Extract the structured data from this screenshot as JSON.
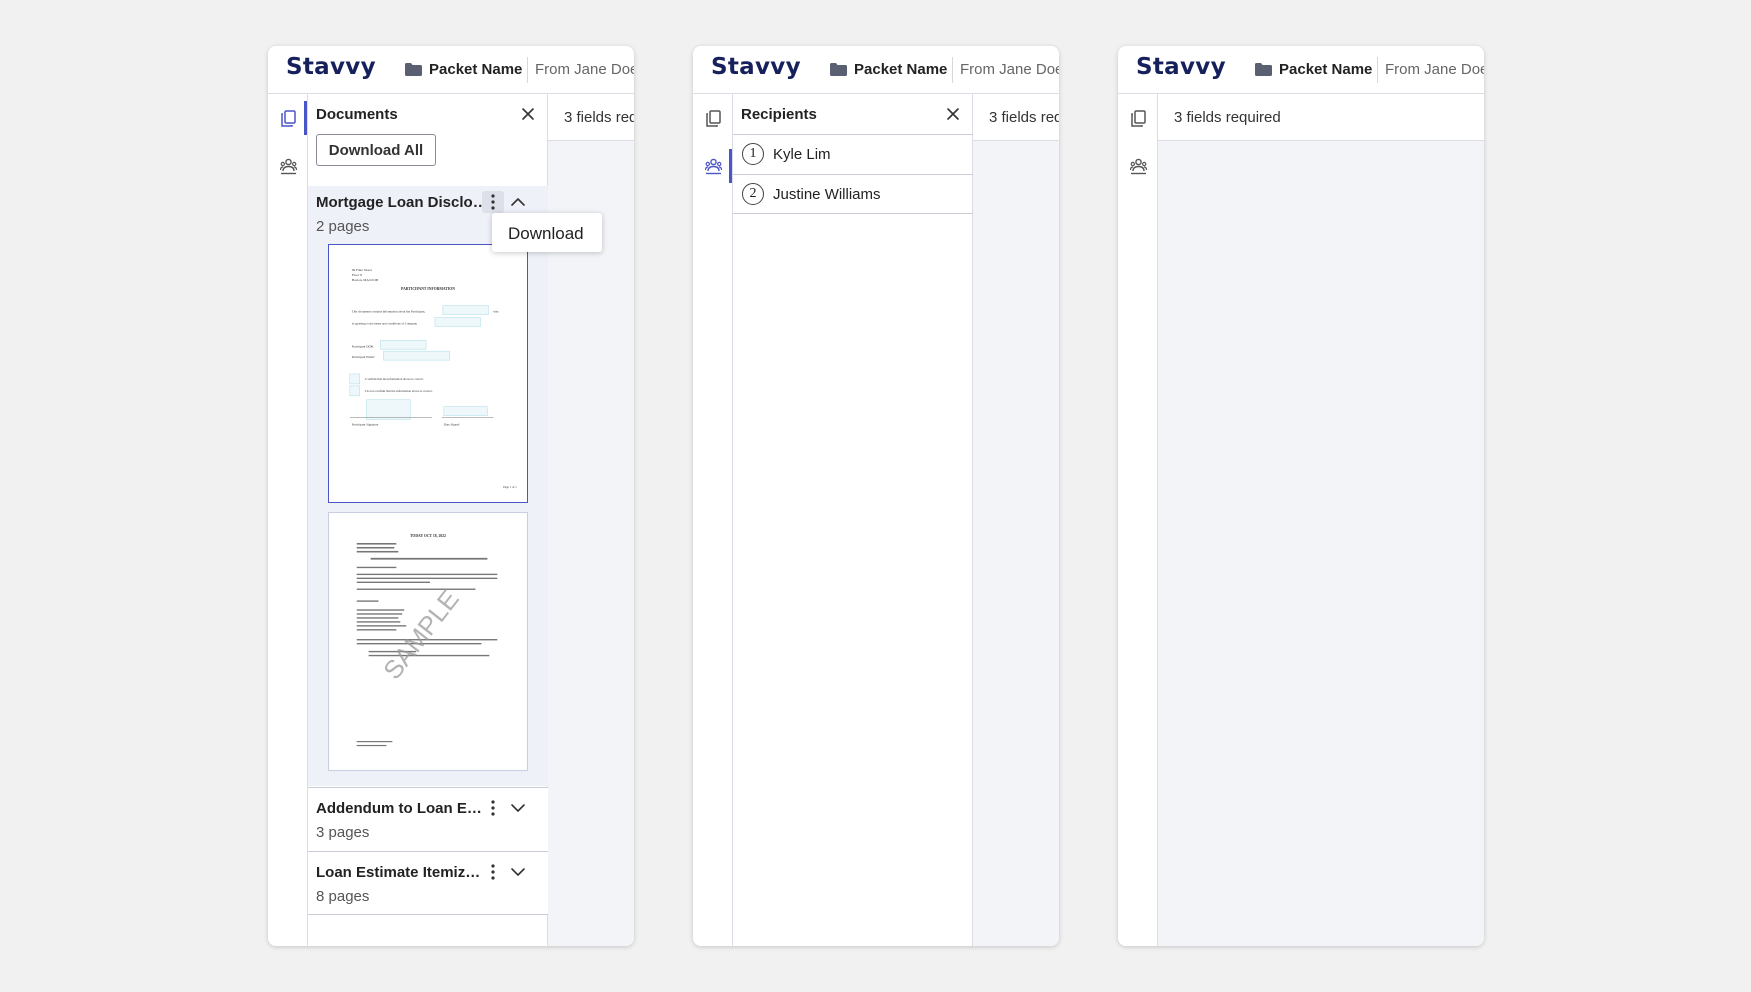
{
  "app": {
    "logo": "Stavvy",
    "packet_name": "Packet Name",
    "from": "From Jane Doe"
  },
  "icons": {
    "folder": "folder-icon",
    "documents": "documents-icon",
    "recipients": "recipients-icon",
    "close": "close-icon",
    "kebab": "more-vertical-icon",
    "expand": "chevron-down-icon",
    "collapse": "chevron-up-icon"
  },
  "colors": {
    "accent": "#4a55c7",
    "logo": "#16215c",
    "panel_bg": "#eff1f8",
    "canvas_bg": "#f3f4f8",
    "page_bg": "#f1f1f1"
  },
  "frames": [
    {
      "id": "documents-view",
      "fields_status": "3 fields req",
      "panel": {
        "title": "Documents",
        "download_all": "Download All",
        "documents": [
          {
            "title": "Mortgage Loan Disclosur...",
            "pages": "2 pages",
            "expanded": true
          },
          {
            "title": "Addendum to Loan Estim...",
            "pages": "3 pages",
            "expanded": false
          },
          {
            "title": "Loan Estimate Itemizatio...",
            "pages": "8 pages",
            "expanded": false
          }
        ],
        "context_menu": {
          "item": "Download"
        }
      },
      "thumbnails": [
        {
          "heading": "PARTICIPANT INFORMATION",
          "address": [
            "99 Fake Street",
            "Floor 8",
            "Boston, MA 02108"
          ],
          "lines": [
            "This document contains information about the Participant,",
            "who",
            "is agreeing to the terms and conditions of Company",
            "Participant DOB:",
            "Participant Email:",
            "I confirm that the information above is correct.",
            "I do not confirm that the information above is correct.",
            "Participant Signature",
            "Date Signed"
          ],
          "footer": "Page 1 of 1"
        },
        {
          "heading": "TODAY OCT 18, 2022",
          "watermark": "SAMPLE"
        }
      ]
    },
    {
      "id": "recipients-view",
      "fields_status": "3 fields req",
      "panel": {
        "title": "Recipients",
        "recipients": [
          {
            "number": "1",
            "name": "Kyle Lim"
          },
          {
            "number": "2",
            "name": "Justine Williams"
          }
        ]
      }
    },
    {
      "id": "collapsed-view",
      "fields_status": "3 fields required"
    }
  ]
}
